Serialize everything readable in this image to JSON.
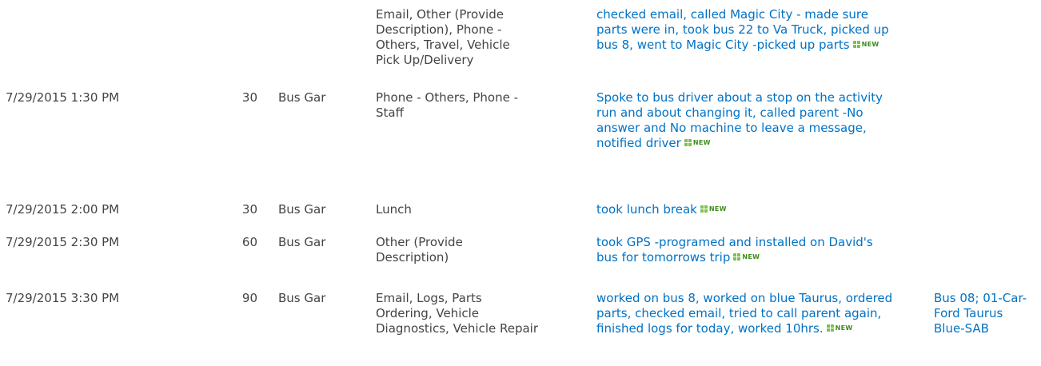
{
  "rows": [
    {
      "date": "",
      "minutes": "",
      "location": "",
      "categories": "Email, Other (Provide Description), Phone - Others, Travel, Vehicle Pick Up/Delivery",
      "description": "checked email, called Magic City - made sure parts were in, took bus 22 to Va Truck, picked up bus 8, went to Magic City -picked up parts",
      "badge": "NEW",
      "vehicles": ""
    },
    {
      "date": "7/29/2015 1:30 PM",
      "minutes": "30",
      "location": "Bus Gar",
      "categories": "Phone - Others, Phone - Staff",
      "description": "Spoke to bus driver about a stop on the activity run and about changing it, called parent -No answer and No machine to leave a message, notified driver",
      "badge": "NEW",
      "vehicles": ""
    },
    {
      "date": "7/29/2015 2:00 PM",
      "minutes": "30",
      "location": "Bus Gar",
      "categories": "Lunch",
      "description": "took lunch break",
      "badge": "NEW",
      "vehicles": ""
    },
    {
      "date": "7/29/2015 2:30 PM",
      "minutes": "60",
      "location": "Bus Gar",
      "categories": "Other (Provide Description)",
      "description": "took GPS -programed and installed on David's bus for tomorrows trip",
      "badge": "NEW",
      "vehicles": ""
    },
    {
      "date": "7/29/2015 3:30 PM",
      "minutes": "90",
      "location": "Bus Gar",
      "categories": "Email, Logs, Parts Ordering, Vehicle Diagnostics, Vehicle Repair",
      "description": "worked on bus 8, worked on blue Taurus, ordered parts, checked email, tried to call parent again, finished logs for today, worked 10hrs.",
      "badge": "NEW",
      "vehicles": "Bus 08; 01-Car-Ford Taurus Blue-SAB"
    }
  ],
  "colors": {
    "text": "#444444",
    "link": "#0072c6",
    "new_badge": "#3d8b1e"
  },
  "icons": {
    "new_badge": "new-item-icon"
  }
}
